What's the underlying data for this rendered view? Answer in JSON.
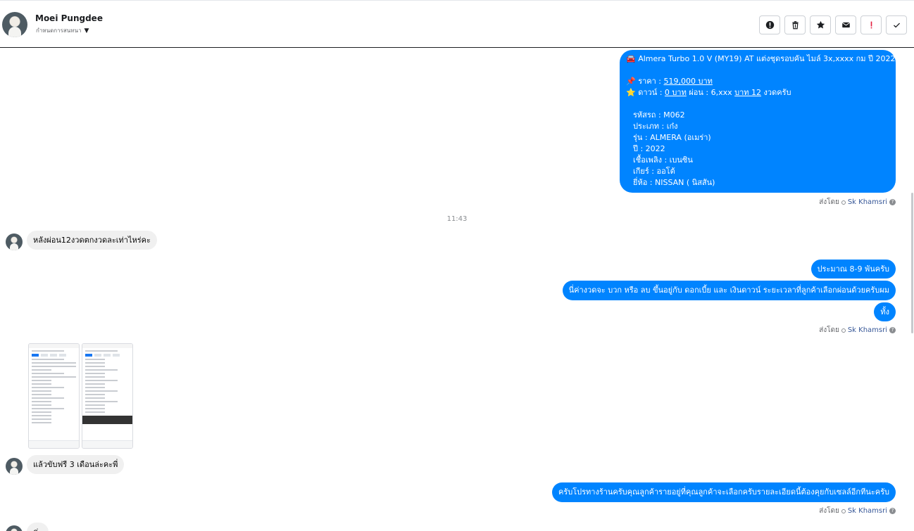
{
  "header": {
    "contact_name": "Moei Pungdee",
    "contact_status": "กำหนดการสนทนา",
    "toolbar_icons": [
      "alert-circle-icon",
      "trash-icon",
      "star-icon",
      "mail-icon",
      "exclamation-icon",
      "check-icon"
    ]
  },
  "messages": {
    "car_listing": {
      "title": "🚘 Almera Turbo 1.0 V (MY19) AT แต่งชุดรอบคัน ไมล์ 3x,xxxx กม ปี 2022",
      "price_prefix": "📌 ราคา : ",
      "price_link": "519,000 บาท",
      "down_prefix": "⭐ ดาวน์ : ",
      "down_link": "0 บาท",
      "down_mid": " ผ่อน : 6,xxx ",
      "down_link2": "บาท 12",
      "down_suffix": " งวดครับ",
      "specs": [
        "รหัสรถ : M062",
        "ประเภท : เก๋ง",
        "รุ่น : ALMERA (อเมร่า)",
        "ปี : 2022",
        "เชื้อเพลิง : เบนซิน",
        "เกียร์ : ออโต้",
        "ยี่ห้อ : NISSAN ( นิสสัน)"
      ]
    },
    "sent_by_1": {
      "prefix": "ส่งโดย",
      "name": "Sk Khamsri"
    },
    "time_1143": "11:43",
    "in_1": "หลังผ่อน12งวดตกงวดละเท่าไหร่คะ",
    "out_1": "ประมาณ 8-9 พันครับ",
    "out_2": "นี่ค่างวดจะ บวก หรือ ลบ ขึ้นอยู่กับ ดอกเบี้ย และ เงินดาวน์ ระยะเวลาที่ลูกค้าเลือกผ่อนด้วยครับผม",
    "out_3": "ทั้ง",
    "sent_by_2": {
      "prefix": "ส่งโดย",
      "name": "Sk Khamsri"
    },
    "in_2": "แล้วขับฟรี 3 เดือนล่ะคะพี่",
    "out_4": "ครับโปรทางร้านครับคุณลูกค้ารายอยู่ที่คุณลูกค้าจะเลือกครับรายละเอียดนี้ต้องคุยกับเซลล์อีกทีนะครับ",
    "sent_by_3": {
      "prefix": "ส่งโดย",
      "name": "Sk Khamsri"
    },
    "in_3_partial": "ค่ะ"
  },
  "colors": {
    "outgoing_bubble": "#0084ff",
    "incoming_bubble": "#f0f0f0",
    "toolbar_alert_red": "#e41e3f"
  }
}
